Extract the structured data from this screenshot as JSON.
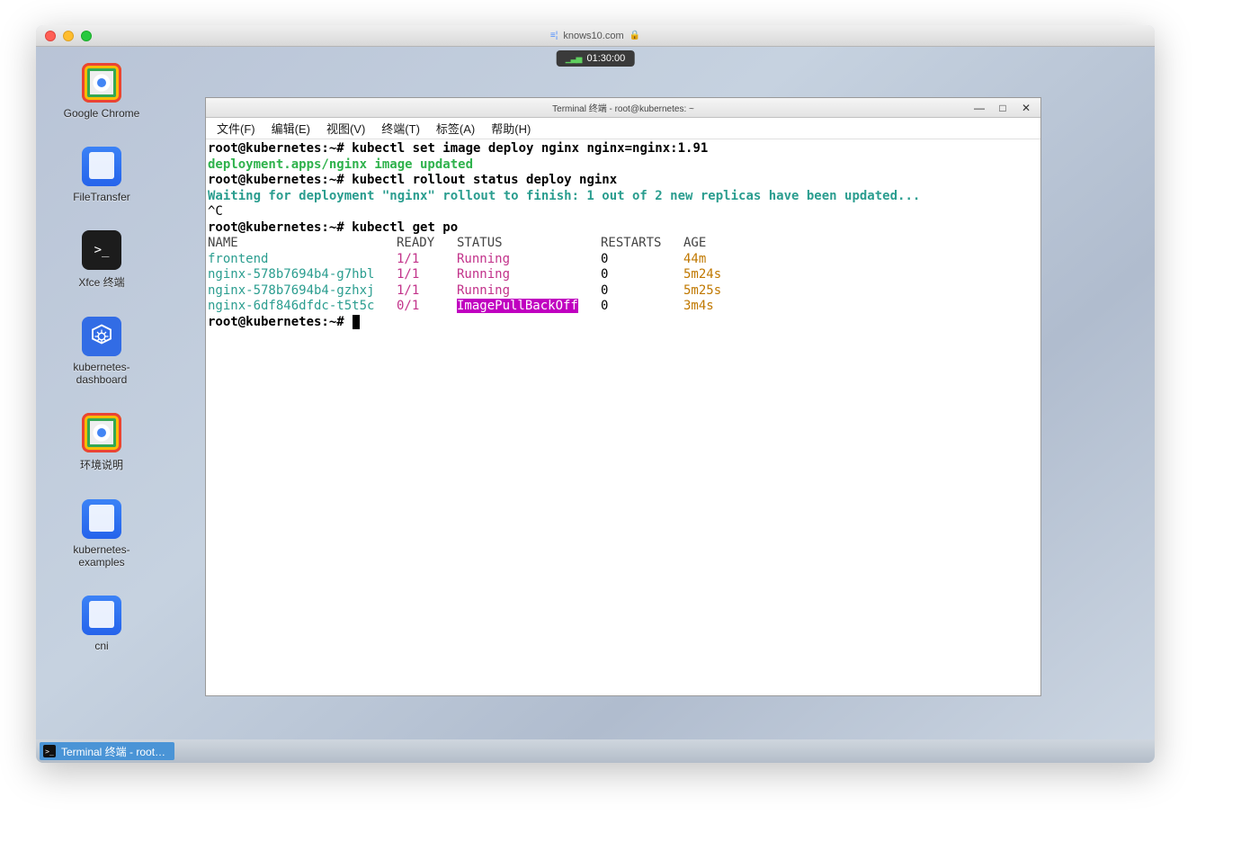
{
  "browser": {
    "url": "knows10.com",
    "timer": "01:30:00"
  },
  "desktop": {
    "items": [
      {
        "label": "Google Chrome",
        "icon": "chrome"
      },
      {
        "label": "FileTransfer",
        "icon": "folder"
      },
      {
        "label": "Xfce 终端",
        "icon": "terminal"
      },
      {
        "label": "kubernetes-dashboard",
        "icon": "k8s"
      },
      {
        "label": "环境说明",
        "icon": "chrome"
      },
      {
        "label": "kubernetes-examples",
        "icon": "folder"
      },
      {
        "label": "cni",
        "icon": "folder"
      }
    ]
  },
  "terminal": {
    "title": "Terminal 终端 - root@kubernetes: ~",
    "menu": [
      "文件(F)",
      "编辑(E)",
      "视图(V)",
      "终端(T)",
      "标签(A)",
      "帮助(H)"
    ],
    "prompt": "root@kubernetes:~# ",
    "lines": {
      "cmd1": "kubectl set image deploy nginx nginx=nginx:1.91",
      "out1": "deployment.apps/nginx image updated",
      "cmd2": "kubectl rollout status deploy nginx",
      "out2": "Waiting for deployment \"nginx\" rollout to finish: 1 out of 2 new replicas have been updated...",
      "interrupt": "^C",
      "cmd3": "kubectl get po",
      "headers": {
        "name": "NAME",
        "ready": "READY",
        "status": "STATUS",
        "restarts": "RESTARTS",
        "age": "AGE"
      },
      "pods": [
        {
          "name": "frontend",
          "ready": "1/1",
          "status": "Running",
          "restarts": "0",
          "age": "44m",
          "statusStyle": "magenta"
        },
        {
          "name": "nginx-578b7694b4-g7hbl",
          "ready": "1/1",
          "status": "Running",
          "restarts": "0",
          "age": "5m24s",
          "statusStyle": "magenta"
        },
        {
          "name": "nginx-578b7694b4-gzhxj",
          "ready": "1/1",
          "status": "Running",
          "restarts": "0",
          "age": "5m25s",
          "statusStyle": "magenta"
        },
        {
          "name": "nginx-6df846dfdc-t5t5c",
          "ready": "0/1",
          "status": "ImagePullBackOff",
          "restarts": "0",
          "age": "3m4s",
          "statusStyle": "magenta-bg"
        }
      ]
    }
  },
  "taskbar": {
    "active": "Terminal 终端 - root…"
  }
}
